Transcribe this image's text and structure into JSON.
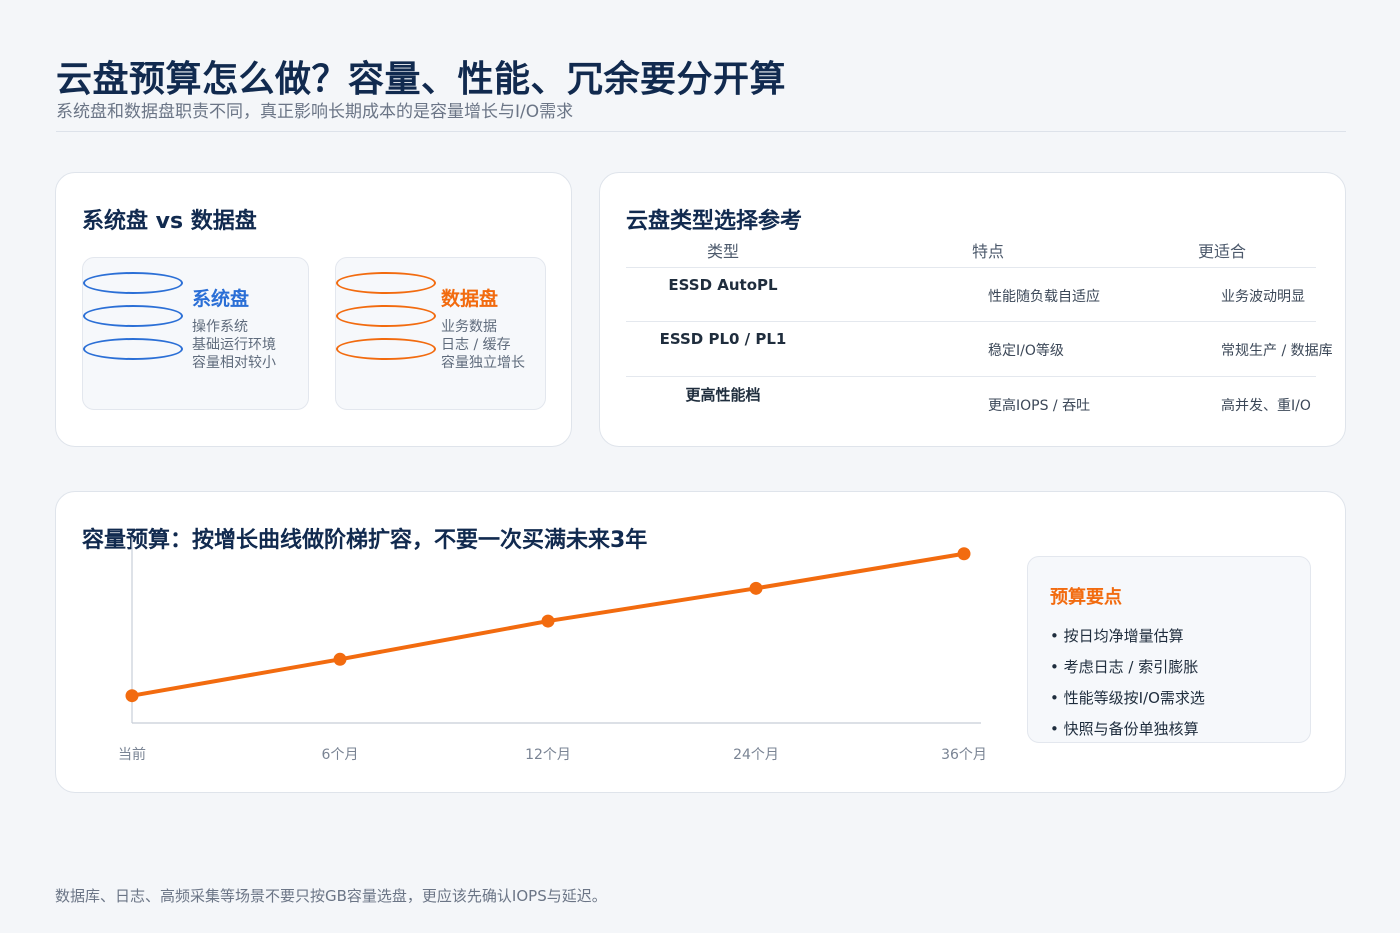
{
  "header": {
    "title": "云盘预算怎么做？容量、性能、冗余要分开算",
    "subtitle": "系统盘和数据盘职责不同，真正影响长期成本的是容量增长与I/O需求"
  },
  "colors": {
    "navy": "#112a4f",
    "blue": "#2b6fd6",
    "orange": "#f26b0f",
    "gray_text": "#6b7586"
  },
  "disks_card": {
    "title": "系统盘 vs 数据盘",
    "system": {
      "name": "系统盘",
      "lines": [
        "操作系统",
        "基础运行环境",
        "容量相对较小"
      ],
      "color": "#2b6fd6"
    },
    "data": {
      "name": "数据盘",
      "lines": [
        "业务数据",
        "日志 / 缓存",
        "容量独立增长"
      ],
      "color": "#f26b0f"
    }
  },
  "types_card": {
    "title": "云盘类型选择参考",
    "headers": [
      "类型",
      "特点",
      "更适合"
    ],
    "rows": [
      {
        "type": "ESSD AutoPL",
        "feature": "性能随负载自适应",
        "fit": "业务波动明显"
      },
      {
        "type": "ESSD PL0 / PL1",
        "feature": "稳定I/O等级",
        "fit": "常规生产 / 数据库"
      },
      {
        "type": "更高性能档",
        "feature": "更高IOPS / 吞吐",
        "fit": "高并发、重I/O"
      }
    ]
  },
  "capacity_card": {
    "title": "容量预算：按增长曲线做阶梯扩容，不要一次买满未来3年",
    "tips_title": "预算要点",
    "tips": [
      "• 按日均净增量估算",
      "• 考虑日志 / 索引膨胀",
      "• 性能等级按I/O需求选",
      "• 快照与备份单独核算"
    ]
  },
  "chart_data": {
    "type": "line",
    "title": "",
    "xlabel": "",
    "ylabel": "",
    "categories": [
      "当前",
      "6个月",
      "12个月",
      "24个月",
      "36个月"
    ],
    "values": [
      15,
      35,
      56,
      74,
      93
    ],
    "ylim": [
      0,
      100
    ],
    "grid": false,
    "series_color": "#f26b0f"
  },
  "footer": {
    "note": "数据库、日志、高频采集等场景不要只按GB容量选盘，更应该先确认IOPS与延迟。"
  }
}
